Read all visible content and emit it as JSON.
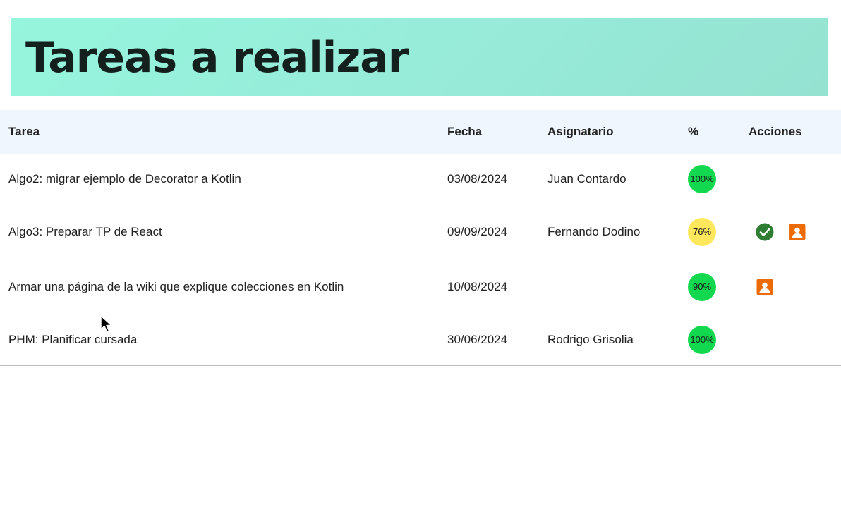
{
  "header": {
    "title": "Tareas a realizar"
  },
  "colors": {
    "complete": "#12d84f",
    "in_progress": "#fde85d",
    "check_icon": "#2e7d32",
    "assign_icon": "#ec6b07"
  },
  "table": {
    "columns": {
      "task": "Tarea",
      "date": "Fecha",
      "assignee": "Asignatario",
      "percent": "%",
      "actions": "Acciones"
    },
    "rows": [
      {
        "task": "Algo2: migrar ejemplo de Decorator a Kotlin",
        "date": "03/08/2024",
        "assignee": "Juan Contardo",
        "percent": "100%",
        "status": "complete",
        "actions": []
      },
      {
        "task": "Algo3: Preparar TP de React",
        "date": "09/09/2024",
        "assignee": "Fernando Dodino",
        "percent": "76%",
        "status": "in_progress",
        "actions": [
          "check-icon",
          "assign-user-icon"
        ]
      },
      {
        "task": "Armar una página de la wiki que explique colecciones en Kotlin",
        "date": "10/08/2024",
        "assignee": "",
        "percent": "90%",
        "status": "complete",
        "actions": [
          "assign-user-icon"
        ]
      },
      {
        "task": "PHM: Planificar cursada",
        "date": "30/06/2024",
        "assignee": "Rodrigo Grisolia",
        "percent": "100%",
        "status": "complete",
        "actions": []
      }
    ]
  }
}
